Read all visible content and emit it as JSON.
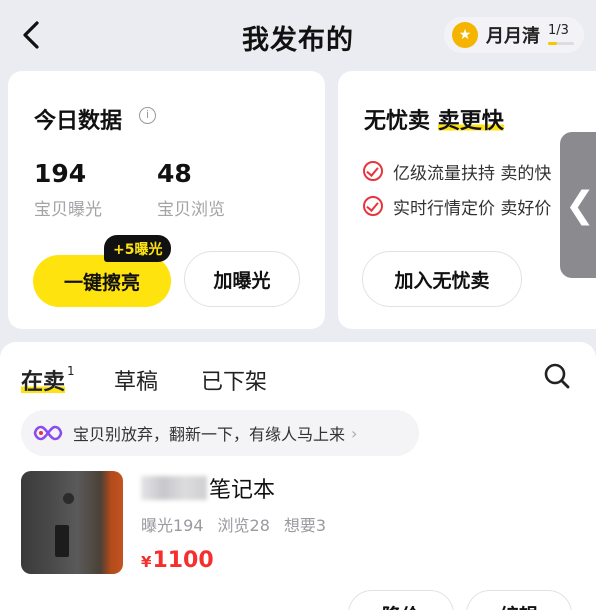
{
  "header": {
    "title": "我发布的",
    "badge": {
      "label": "月月清",
      "progress_text": "1/3",
      "progress": 0.33
    }
  },
  "stats_card": {
    "title": "今日数据",
    "exposure": {
      "value": "194",
      "label": "宝贝曝光"
    },
    "views": {
      "value": "48",
      "label": "宝贝浏览"
    },
    "polish_button": "一键擦亮",
    "polish_tip": "+5曝光",
    "boost_button": "加曝光"
  },
  "promo_card": {
    "title_prefix": "无忧卖",
    "title_highlight": "卖更快",
    "features": [
      "亿级流量扶持 卖的快",
      "实时行情定价 卖好价"
    ],
    "join_button": "加入无忧卖"
  },
  "tabs": [
    {
      "label": "在卖",
      "count": "1",
      "active": true
    },
    {
      "label": "草稿",
      "active": false
    },
    {
      "label": "已下架",
      "active": false
    }
  ],
  "banner": {
    "text": "宝贝别放弃，翻新一下，有缘人马上来"
  },
  "listing": {
    "title": "笔记本",
    "exposure": "曝光194",
    "views": "浏览28",
    "wants": "想要3",
    "currency": "¥",
    "price": "1100",
    "actions": [
      "降价",
      "编辑"
    ]
  },
  "colors": {
    "accent_yellow": "#ffe30f",
    "price_red": "#f52e2e",
    "check_red": "#e8353c"
  }
}
